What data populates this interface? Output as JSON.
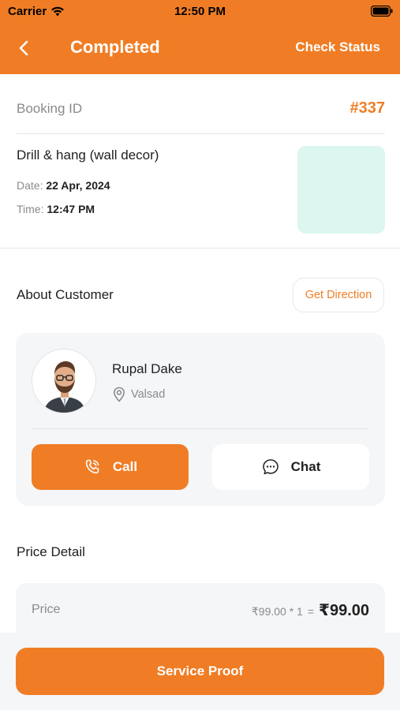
{
  "status_bar": {
    "carrier": "Carrier",
    "time": "12:50 PM"
  },
  "nav": {
    "title": "Completed",
    "action": "Check Status"
  },
  "booking": {
    "id_label": "Booking ID",
    "id_value": "#337",
    "service_title": "Drill & hang (wall decor)",
    "date_label": "Date:",
    "date_value": "22 Apr, 2024",
    "time_label": "Time:",
    "time_value": "12:47 PM"
  },
  "customer_section": {
    "title": "About Customer",
    "direction_label": "Get Direction",
    "name": "Rupal Dake",
    "location": "Valsad",
    "call_label": "Call",
    "chat_label": "Chat"
  },
  "price_section": {
    "title": "Price Detail",
    "price_label": "Price",
    "unit_calc": "₹99.00 * 1",
    "eq": "=",
    "total": "₹99.00"
  },
  "footer": {
    "button_label": "Service Proof"
  },
  "colors": {
    "accent": "#f07d25",
    "thumb_bg": "#dcf7ef",
    "card_bg": "#f4f6f8"
  }
}
